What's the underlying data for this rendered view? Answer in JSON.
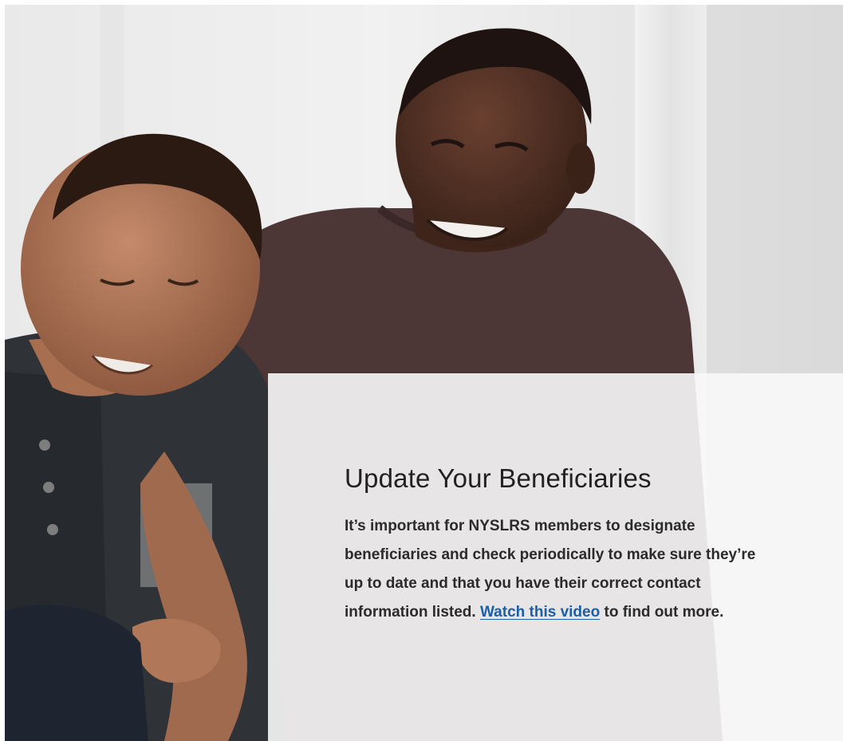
{
  "hero": {
    "photo_icon": "photo-father-and-son-icon"
  },
  "card": {
    "title": "Update Your Beneficiaries",
    "body_before_link": "It’s important for NYSLRS members to designate beneficiaries and check periodically to make sure they’re up to date and that you have their correct contact information listed. ",
    "link_text": "Watch this video",
    "body_after_link": " to find out more."
  },
  "colors": {
    "link": "#1b5fa8",
    "title_text": "#222222",
    "body_text": "#2b2b2b",
    "card_background": "#f8f8f8"
  }
}
